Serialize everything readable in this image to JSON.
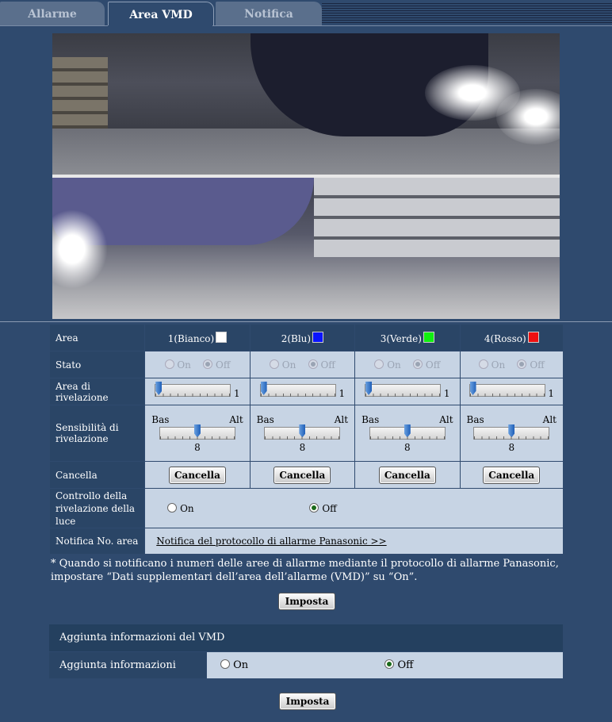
{
  "tabs": [
    {
      "label": "Allarme"
    },
    {
      "label": "Area VMD"
    },
    {
      "label": "Notifica"
    }
  ],
  "table": {
    "area_label": "Area",
    "stato_label": "Stato",
    "rivelazione_label": "Area di rivelazione",
    "sensibilita_label": "Sensibilità di rivelazione",
    "cancella_label": "Cancella",
    "controllo_label": "Controllo della rivelazione della luce",
    "notifica_label": "Notifica No. area",
    "areas": [
      {
        "name": "1(Bianco)",
        "color": "#ffffff",
        "on": "On",
        "off": "Off",
        "rivelazione": "1",
        "bas": "Bas",
        "alt": "Alt",
        "sens": "8",
        "sens_level": 0.5,
        "cancella": "Cancella"
      },
      {
        "name": "2(Blu)",
        "color": "#0a14ff",
        "on": "On",
        "off": "Off",
        "rivelazione": "1",
        "bas": "Bas",
        "alt": "Alt",
        "sens": "8",
        "sens_level": 0.5,
        "cancella": "Cancella"
      },
      {
        "name": "3(Verde)",
        "color": "#10f010",
        "on": "On",
        "off": "Off",
        "rivelazione": "1",
        "bas": "Bas",
        "alt": "Alt",
        "sens": "8",
        "sens_level": 0.5,
        "cancella": "Cancella"
      },
      {
        "name": "4(Rosso)",
        "color": "#f01010",
        "on": "On",
        "off": "Off",
        "rivelazione": "1",
        "bas": "Bas",
        "alt": "Alt",
        "sens": "8",
        "sens_level": 0.5,
        "cancella": "Cancella"
      }
    ],
    "controllo_on": "On",
    "controllo_off": "Off",
    "notifica_link": "Notifica del protocollo di allarme Panasonic >>"
  },
  "note": "* Quando si notificano i numeri delle aree di allarme mediante il protocollo di allarme Panasonic, impostare “Dati supplementari dell’area dell’allarme (VMD)” su “On”.",
  "imposta1": "Imposta",
  "vmd": {
    "header": "Aggiunta informazioni del VMD",
    "row_label": "Aggiunta informazioni",
    "on": "On",
    "off": "Off"
  },
  "imposta2": "Imposta"
}
